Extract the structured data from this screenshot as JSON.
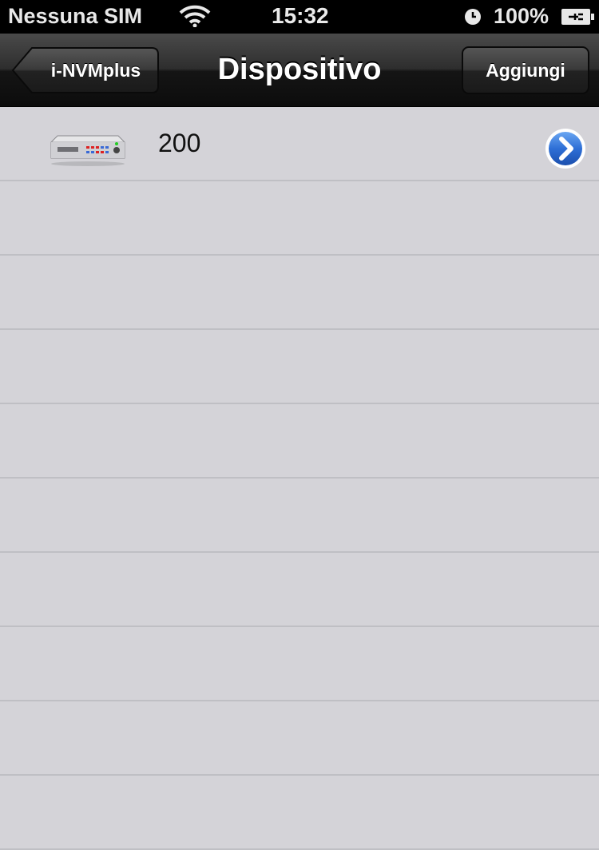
{
  "status_bar": {
    "carrier": "Nessuna SIM",
    "time": "15:32",
    "battery": "100%"
  },
  "nav_bar": {
    "back_label": "i-NVMplus",
    "title": "Dispositivo",
    "add_label": "Aggiungi"
  },
  "devices": [
    {
      "name": "200",
      "icon": "dvr-device-icon"
    }
  ],
  "colors": {
    "background": "#d4d3d8",
    "separator": "#bfbfc4",
    "disclosure": "#2e6fd6",
    "bar": "#1a1a1a"
  }
}
